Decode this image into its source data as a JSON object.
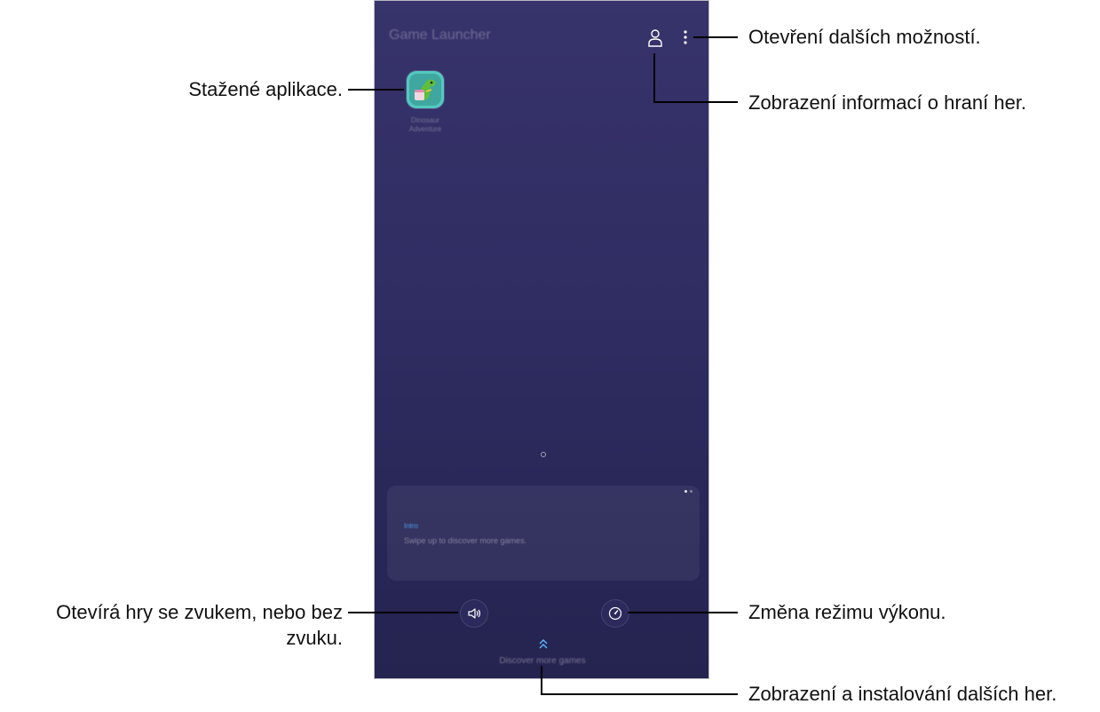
{
  "screen": {
    "app_title": "Game Launcher",
    "app_name": "Dinosaur Adventure",
    "card_tag": "Intro",
    "card_text": "Swipe up to discover more games.",
    "discover_label": "Discover more games",
    "icons": {
      "profile": "profile-icon",
      "more": "more-options-icon",
      "sound": "sound-icon",
      "performance": "performance-icon",
      "discover": "chevron-up-icon"
    }
  },
  "callouts": {
    "more_options": "Otevření dalších možností.",
    "game_info": "Zobrazení informací o hraní her.",
    "downloaded_apps": "Stažené aplikace.",
    "sound_line1": "Otevírá hry se zvukem, nebo bez",
    "sound_line2": "zvuku.",
    "performance": "Změna režimu výkonu.",
    "discover_more": "Zobrazení a instalování dalších her."
  },
  "colors": {
    "screen_top": "#37336b",
    "screen_bottom": "#25234f",
    "leader_line": "#000000",
    "card_tag": "#4d9fe6"
  }
}
